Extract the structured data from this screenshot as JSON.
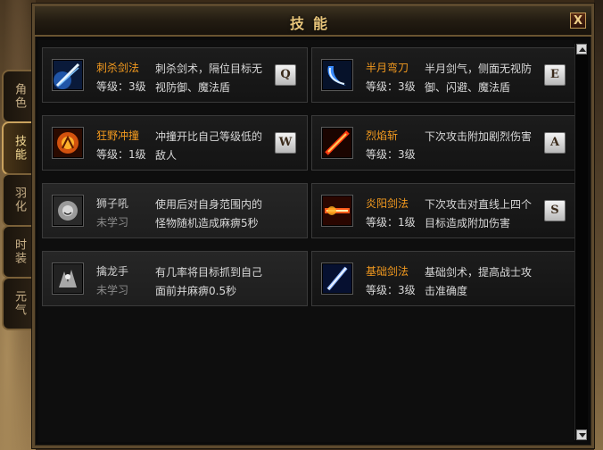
{
  "window": {
    "title": "技能",
    "close_label": "X"
  },
  "tabs": [
    {
      "label": "角色",
      "active": false
    },
    {
      "label": "技能",
      "active": true
    },
    {
      "label": "羽化",
      "active": false
    },
    {
      "label": "时装",
      "active": false
    },
    {
      "label": "元气",
      "active": false
    }
  ],
  "skills": [
    {
      "name": "刺杀剑法",
      "level": "等级：3级",
      "desc": "刺杀剑术，隔位目标无视防御、魔法盾",
      "hotkey": "Q",
      "icon": "thrust-sword-icon",
      "learned": true
    },
    {
      "name": "半月弯刀",
      "level": "等级：3级",
      "desc": "半月剑气，侧面无视防御、闪避、魔法盾",
      "hotkey": "E",
      "icon": "crescent-blade-icon",
      "learned": true
    },
    {
      "name": "狂野冲撞",
      "level": "等级：1级",
      "desc": "冲撞开比自己等级低的敌人",
      "hotkey": "W",
      "icon": "wild-charge-icon",
      "learned": true
    },
    {
      "name": "烈焰斩",
      "level": "等级：3级",
      "desc": "下次攻击附加剧烈伤害",
      "hotkey": "A",
      "icon": "flame-slash-icon",
      "learned": true
    },
    {
      "name": "狮子吼",
      "level": "未学习",
      "desc": "使用后对自身范围内的怪物随机造成麻痹5秒",
      "hotkey": "",
      "icon": "lion-roar-icon",
      "learned": false
    },
    {
      "name": "炎阳剑法",
      "level": "等级：1级",
      "desc": "下次攻击对直线上四个目标造成附加伤害",
      "hotkey": "S",
      "icon": "blazing-sun-sword-icon",
      "learned": true
    },
    {
      "name": "擒龙手",
      "level": "未学习",
      "desc": "有几率将目标抓到自己面前并麻痹0.5秒",
      "hotkey": "",
      "icon": "dragon-grab-icon",
      "learned": false
    },
    {
      "name": "基础剑法",
      "level": "等级：3级",
      "desc": "基础剑术，提高战士攻击准确度",
      "hotkey": "",
      "icon": "basic-sword-icon",
      "learned": true
    }
  ]
}
